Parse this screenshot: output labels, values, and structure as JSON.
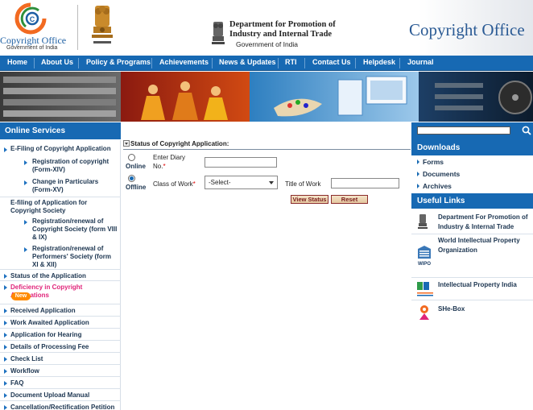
{
  "header": {
    "logo_title": "Copyright Office",
    "logo_subtitle": "Government of India",
    "dept_line1": "Department for Promotion of",
    "dept_line2": "Industry and Internal Trade",
    "dept_line3": "Government of India",
    "brand": "Copyright Office"
  },
  "nav": {
    "items": [
      "Home",
      "About Us",
      "Policy & Programs",
      "Achievements",
      "News & Updates",
      "RTI",
      "Contact Us",
      "Helpdesk",
      "Journal"
    ]
  },
  "sidebar": {
    "title": "Online Services",
    "items": [
      "E-Filing of Copyright Application",
      "Registration of copyright (Form-XIV)",
      "Change in Particulars (Form-XV)",
      "E-filing of Application for Copyright Society",
      "Registration/renewal of Copyright Society (form VIII & IX)",
      "Registration/renewal of Performers' Society (form XI & XII)",
      "Status of the Application",
      "Deficiency in Copyright Applications",
      "Received Application",
      "Work Awaited Application",
      "Application for Hearing",
      "Details of Processing Fee",
      "Check List",
      "Workflow",
      "FAQ",
      "Document Upload Manual",
      "Cancellation/Rectification Petition"
    ],
    "new_badge": "New"
  },
  "form": {
    "title": "Status of Copyright Application:",
    "radio_online": "Online",
    "radio_offline": "Offline",
    "selected": "Offline",
    "diary_label_1": "Enter Diary",
    "diary_label_2": "No.",
    "diary_value": "",
    "class_label": "Class of Work",
    "class_selected": "-Select-",
    "title_label": "Title of Work",
    "title_value": "",
    "view_status": "View Status",
    "reset": "Reset"
  },
  "right": {
    "search_value": "",
    "downloads_title": "Downloads",
    "downloads": [
      "Forms",
      "Documents",
      "Archives"
    ],
    "useful_title": "Useful Links",
    "useful_links": [
      "Department For Promotion of Industry & Internal Trade",
      "World Intellectual Property Organization",
      "Intellectual Property India",
      "SHe-Box"
    ]
  },
  "colors": {
    "primary_blue": "#1769b3",
    "accent_pink": "#e0247a",
    "accent_orange": "#f26a21"
  }
}
